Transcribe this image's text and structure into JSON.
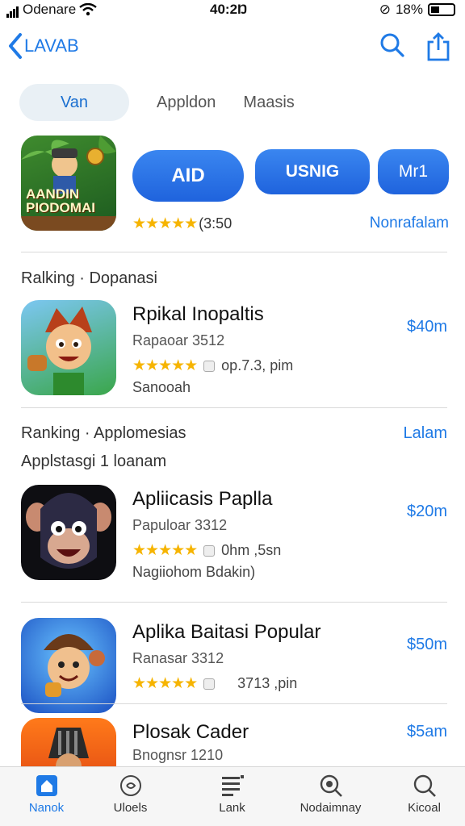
{
  "status": {
    "carrier": "Odenare",
    "time": "40:2Ŋ",
    "battery": "18%"
  },
  "nav": {
    "back_label": "LAVAB"
  },
  "segments": {
    "selected": "Van",
    "items": [
      "Appldon",
      "Maasis"
    ]
  },
  "featured": {
    "art_title": "AANDIN PIODOMAI",
    "buttons": [
      "AID",
      "USNIG",
      "Mr1"
    ],
    "stars": "★★★★★",
    "rating_text": "(3:50",
    "link": "Nonrafalam"
  },
  "section1": {
    "title": "Ralking · Dopanasi"
  },
  "section2": {
    "title": "Ranking · Applomesias",
    "link": "Lalam",
    "subtitle": "Applstasgi 1   loanam"
  },
  "apps": [
    {
      "name": "Rpikal Inopaltis",
      "sub": "Rapaoar 3512",
      "stars": "★★★★★",
      "meta": "op.7.3, pim",
      "extra": "Sanooah",
      "price": "$40m"
    },
    {
      "name": "Apliicasis Paplla",
      "sub": "Papuloar 3312",
      "stars": "★★★★★",
      "meta": "0hm ,5sn",
      "extra": "Nagiiohom Bdakin)",
      "price": "$20m"
    },
    {
      "name": "Aplika Baitasi Popular",
      "sub": "Ranasar 3312",
      "stars": "★★★★★",
      "meta": "3713 ,pin",
      "extra": "",
      "price": "$50m"
    },
    {
      "name": "Plosak Cader",
      "sub": "Bnognsr 1210",
      "stars": "",
      "meta": "",
      "extra": "",
      "price": "$5am"
    }
  ],
  "tabs": [
    {
      "label": "Nanok",
      "icon": "home-icon"
    },
    {
      "label": "Uloels",
      "icon": "games-icon"
    },
    {
      "label": "Lank",
      "icon": "list-icon"
    },
    {
      "label": "Nodaimnay",
      "icon": "search-alt-icon"
    },
    {
      "label": "Kicoal",
      "icon": "search-icon"
    }
  ],
  "colors": {
    "accent": "#1f7ae6",
    "star": "#f6b400"
  }
}
